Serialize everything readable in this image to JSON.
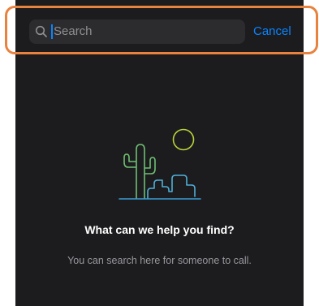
{
  "search": {
    "placeholder": "Search",
    "cancel_label": "Cancel",
    "icon": "magnifying-glass"
  },
  "empty_state": {
    "illustration": "desert-cactus-sun",
    "title": "What can we help you find?",
    "subtitle": "You can search here for someone to call."
  },
  "colors": {
    "background": "#1c1c1e",
    "search_field": "#2c2c2e",
    "accent": "#0a84ff",
    "highlight_frame": "#e8823f",
    "cactus": "#6fbf73",
    "sun": "#b8d33a",
    "ground": "#3a9fd6"
  }
}
